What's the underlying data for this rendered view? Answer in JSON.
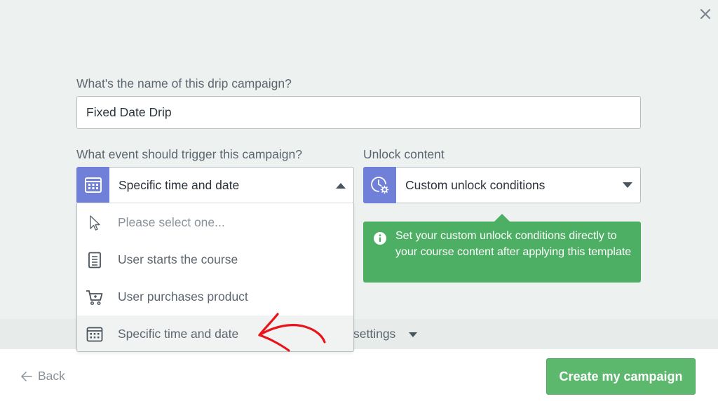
{
  "form": {
    "name_label": "What's the name of this drip campaign?",
    "name_value": "Fixed Date Drip",
    "trigger_label": "What event should trigger this campaign?",
    "unlock_label": "Unlock content"
  },
  "trigger_select": {
    "icon": "calendar-icon",
    "selected": "Specific time and date",
    "expanded": true,
    "options": [
      {
        "label": "Please select one...",
        "icon": "cursor-icon",
        "placeholder": true
      },
      {
        "label": "User starts the course",
        "icon": "document-icon"
      },
      {
        "label": "User purchases product",
        "icon": "cart-icon"
      },
      {
        "label": "Specific time and date",
        "icon": "calendar-icon",
        "highlighted": true
      }
    ]
  },
  "unlock_select": {
    "icon": "clock-gear-icon",
    "selected": "Custom unlock conditions"
  },
  "info_box": {
    "icon": "info-icon",
    "text": "Set your custom unlock conditions directly to your course content after applying this template"
  },
  "settings_toggle": {
    "label": "settings"
  },
  "footer": {
    "back_label": "Back",
    "create_label": "Create my campaign"
  },
  "colors": {
    "accent_purple": "#7080d8",
    "success_green": "#4caf63",
    "button_green": "#5bb86d",
    "annotation_red": "#e8141c"
  }
}
